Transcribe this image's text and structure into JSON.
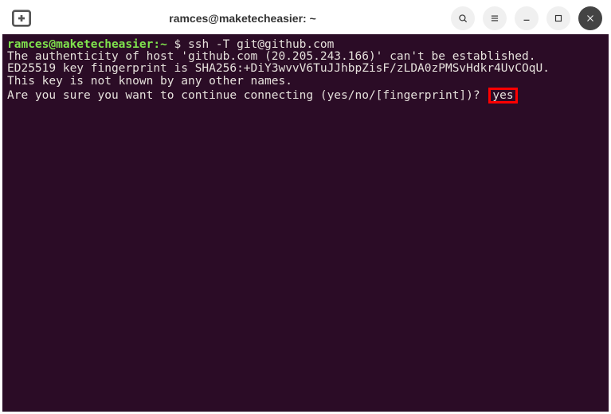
{
  "window": {
    "title": "ramces@maketecheasier: ~"
  },
  "terminal": {
    "prompt_user": "ramces@maketecheasier",
    "prompt_path": "~",
    "prompt_sep": ":",
    "prompt_symbol": "$",
    "command": "ssh -T git@github.com",
    "line1": "The authenticity of host 'github.com (20.205.243.166)' can't be established.",
    "line2": "ED25519 key fingerprint is SHA256:+DiY3wvvV6TuJJhbpZisF/zLDA0zPMSvHdkr4UvCOqU.",
    "line3": "This key is not known by any other names.",
    "line4_q": "Are you sure you want to continue connecting (yes/no/[fingerprint])?",
    "line4_answer": "yes"
  }
}
